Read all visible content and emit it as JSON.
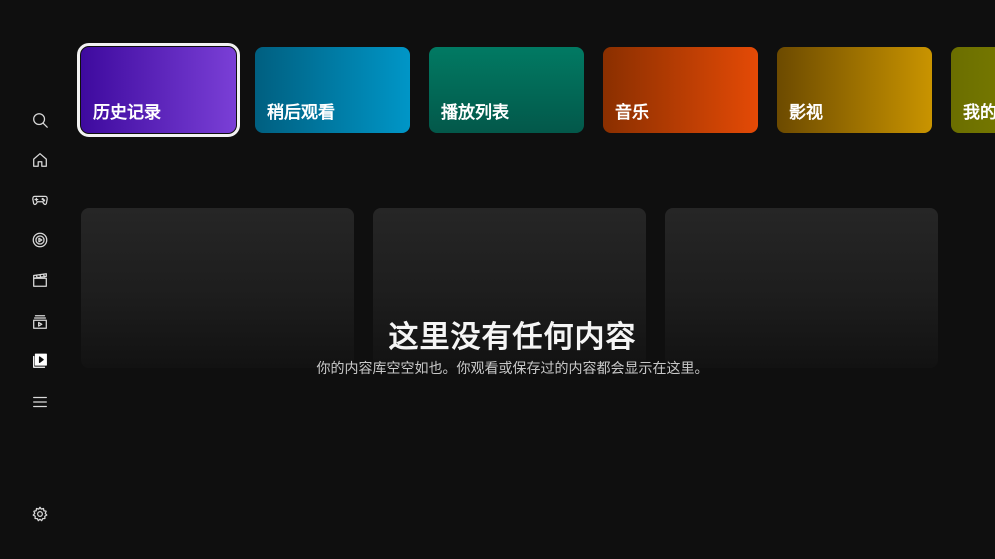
{
  "sidebar": {
    "items": [
      {
        "icon": "search-icon"
      },
      {
        "icon": "home-icon"
      },
      {
        "icon": "gamepad-icon"
      },
      {
        "icon": "target-icon"
      },
      {
        "icon": "clapperboard-icon"
      },
      {
        "icon": "tv-icon"
      },
      {
        "icon": "library-icon"
      },
      {
        "icon": "menu-icon"
      }
    ],
    "settings_icon": "gear-icon"
  },
  "categories": [
    {
      "label": "历史记录",
      "focused": true
    },
    {
      "label": "稍后观看"
    },
    {
      "label": "播放列表"
    },
    {
      "label": "音乐"
    },
    {
      "label": "影视"
    },
    {
      "label": "我的"
    }
  ],
  "empty_state": {
    "title": "这里没有任何内容",
    "subtitle": "你的内容库空空如也。你观看或保存过的内容都会显示在这里。"
  },
  "colors": {
    "background": "#0f0f0f",
    "history": "#5a23c2",
    "watch_later": "#0087b5",
    "playlist": "#016b57",
    "music": "#c83f05",
    "video": "#a77c00",
    "mine": "#7c7e00"
  }
}
